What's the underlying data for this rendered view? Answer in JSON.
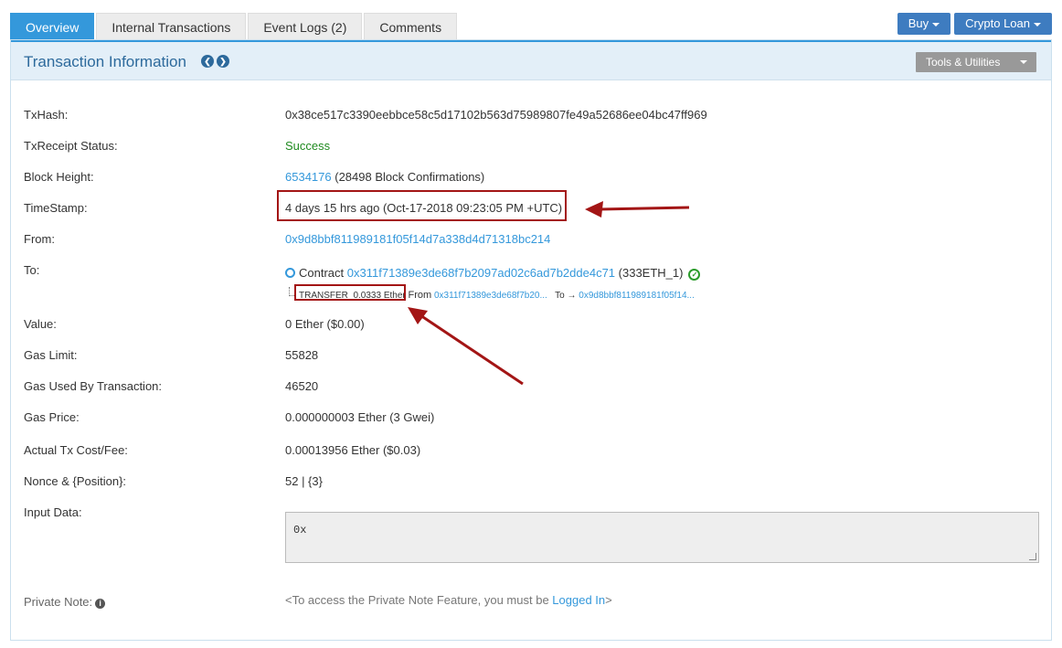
{
  "tabs": [
    {
      "label": "Overview"
    },
    {
      "label": "Internal Transactions"
    },
    {
      "label": "Event Logs (2)"
    },
    {
      "label": "Comments"
    }
  ],
  "top_buttons": {
    "buy": "Buy",
    "crypto_loan": "Crypto Loan"
  },
  "panel": {
    "title": "Transaction Information",
    "tools_label": "Tools & Utilities"
  },
  "fields": {
    "txhash": {
      "label": "TxHash:",
      "value": "0x38ce517c3390eebbce58c5d17102b563d75989807fe49a52686ee04bc47ff969"
    },
    "status": {
      "label": "TxReceipt Status:",
      "value": "Success"
    },
    "block": {
      "label": "Block Height:",
      "link": "6534176",
      "suffix": " (28498 Block Confirmations)"
    },
    "timestamp": {
      "label": "TimeStamp:",
      "value": "4 days 15 hrs ago (Oct-17-2018 09:23:05 PM +UTC)"
    },
    "from": {
      "label": "From:",
      "value": "0x9d8bbf811989181f05f14d7a338d4d71318bc214"
    },
    "to": {
      "label": "To:",
      "prefix": "Contract",
      "address": "0x311f71389e3de68f7b2097ad02c6ad7b2dde4c71",
      "suffix": " (333ETH_1)"
    },
    "transfer": {
      "type_label": "TRANSFER",
      "amount": "0.0333 Ether",
      "from_label": "From",
      "from_addr": "0x311f71389e3de68f7b20...",
      "to_label": "To",
      "arrow": "→",
      "to_addr": "0x9d8bbf811989181f05f14..."
    },
    "value": {
      "label": "Value:",
      "value": "0 Ether ($0.00)"
    },
    "gas_limit": {
      "label": "Gas Limit:",
      "value": "55828"
    },
    "gas_used": {
      "label": "Gas Used By Transaction:",
      "value": "46520"
    },
    "gas_price": {
      "label": "Gas Price:",
      "value": "0.000000003 Ether (3 Gwei)"
    },
    "tx_cost": {
      "label": "Actual Tx Cost/Fee:",
      "value": "0.00013956 Ether ($0.03)"
    },
    "nonce": {
      "label": "Nonce & {Position}:",
      "value": "52 | {3}"
    },
    "input": {
      "label": "Input Data:",
      "value": "0x"
    },
    "private_note": {
      "label": "Private Note:",
      "prefix": "<To access the Private Note Feature, you must be ",
      "link": "Logged In",
      "suffix": ">"
    }
  },
  "colors": {
    "accent": "#3498db",
    "annotation": "#a31515",
    "success": "#1f8a1f"
  }
}
